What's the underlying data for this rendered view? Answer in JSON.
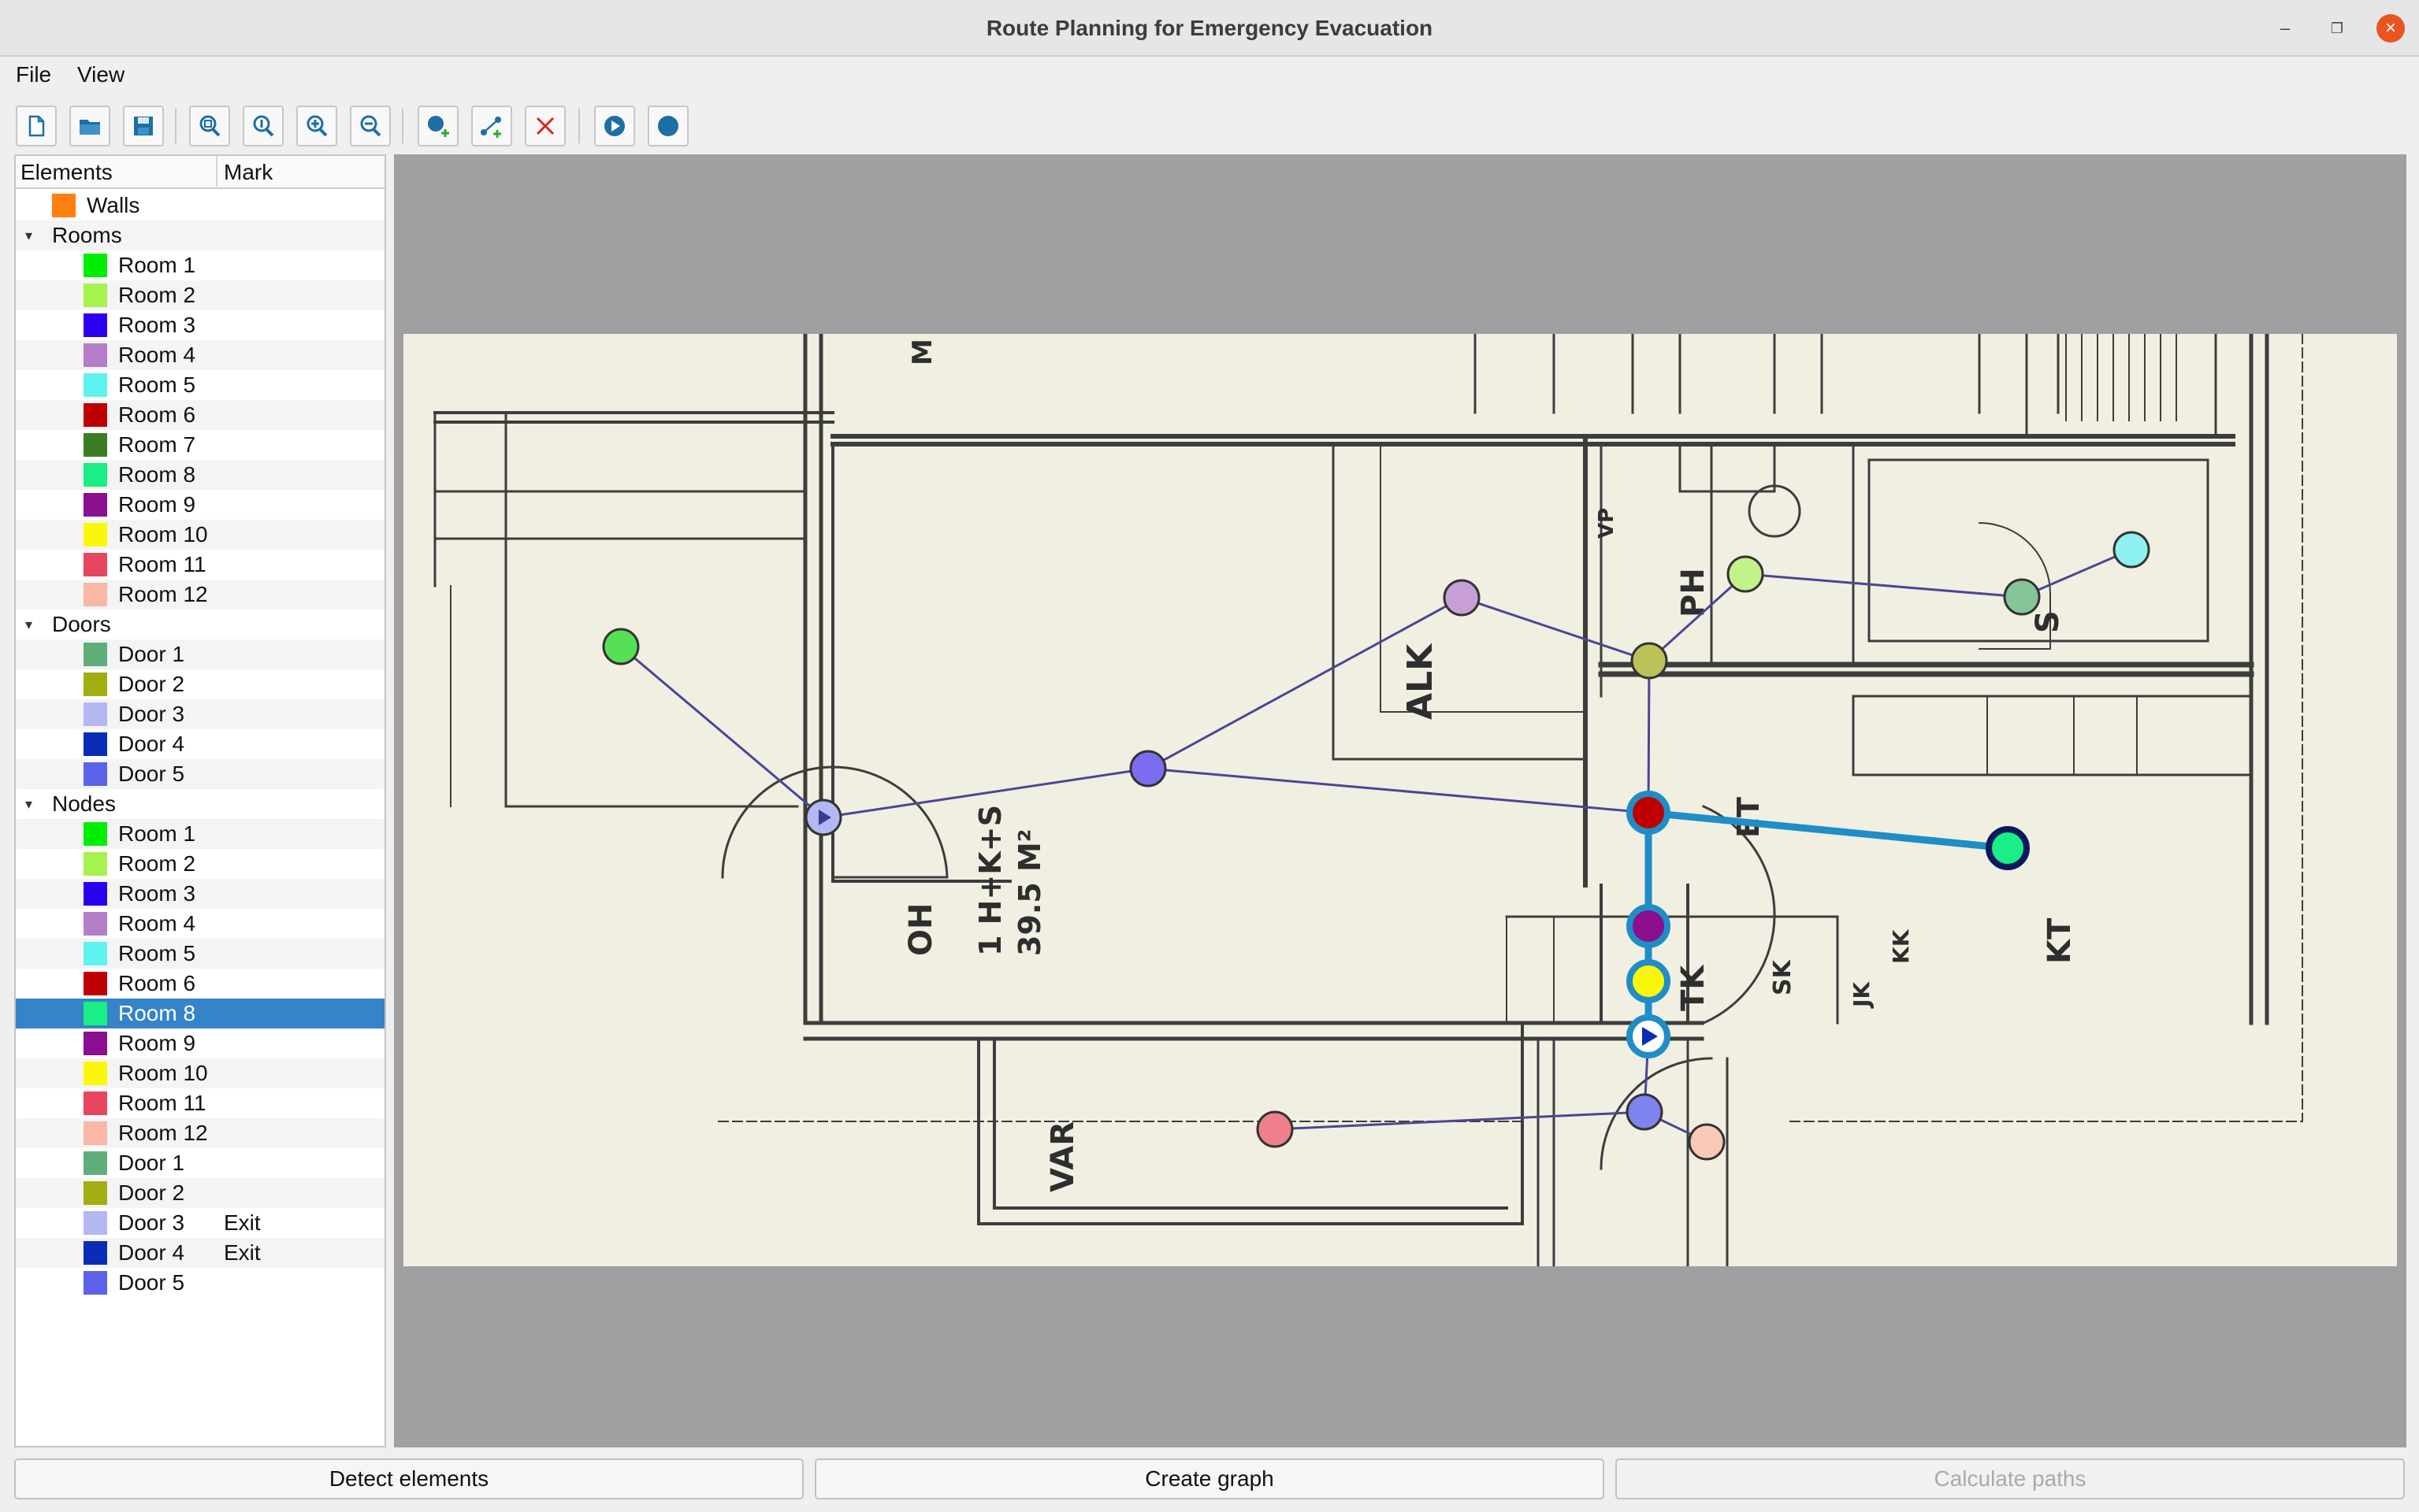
{
  "window": {
    "title": "Route Planning for Emergency Evacuation"
  },
  "menu": {
    "file": "File",
    "view": "View"
  },
  "toolbar": {
    "icons": [
      "new-file-icon",
      "open-folder-icon",
      "save-icon",
      "zoom-fit-icon",
      "zoom-reset-icon",
      "zoom-in-icon",
      "zoom-out-icon",
      "add-node-icon",
      "add-edge-icon",
      "delete-icon",
      "play-icon",
      "record-icon"
    ]
  },
  "panel": {
    "col_elements": "Elements",
    "col_mark": "Mark",
    "walls": {
      "label": "Walls",
      "color": "#ff7f0e"
    },
    "rooms_group": "Rooms",
    "rooms": [
      {
        "label": "Room 1",
        "color": "#00ee00"
      },
      {
        "label": "Room 2",
        "color": "#a6f24f"
      },
      {
        "label": "Room 3",
        "color": "#2b00f0"
      },
      {
        "label": "Room 4",
        "color": "#b57ec8"
      },
      {
        "label": "Room 5",
        "color": "#5ff3f0"
      },
      {
        "label": "Room 6",
        "color": "#c00000"
      },
      {
        "label": "Room 7",
        "color": "#3b7d22"
      },
      {
        "label": "Room 8",
        "color": "#1aee86"
      },
      {
        "label": "Room 9",
        "color": "#8b0f8f"
      },
      {
        "label": "Room 10",
        "color": "#fbf70a"
      },
      {
        "label": "Room 11",
        "color": "#e8455f"
      },
      {
        "label": "Room 12",
        "color": "#f9b7a5"
      }
    ],
    "doors_group": "Doors",
    "doors": [
      {
        "label": "Door 1",
        "color": "#5fae7a"
      },
      {
        "label": "Door 2",
        "color": "#a2ad12"
      },
      {
        "label": "Door 3",
        "color": "#b3b8f2"
      },
      {
        "label": "Door 4",
        "color": "#0a2db8"
      },
      {
        "label": "Door 5",
        "color": "#5d62ea"
      }
    ],
    "nodes_group": "Nodes",
    "nodes": [
      {
        "label": "Room 1",
        "color": "#00ee00",
        "mark": ""
      },
      {
        "label": "Room 2",
        "color": "#a6f24f",
        "mark": ""
      },
      {
        "label": "Room 3",
        "color": "#2b00f0",
        "mark": ""
      },
      {
        "label": "Room 4",
        "color": "#b57ec8",
        "mark": ""
      },
      {
        "label": "Room 5",
        "color": "#5ff3f0",
        "mark": ""
      },
      {
        "label": "Room 6",
        "color": "#c00000",
        "mark": ""
      },
      {
        "label": "Room 8",
        "color": "#1aee86",
        "mark": ""
      },
      {
        "label": "Room 9",
        "color": "#8b0f8f",
        "mark": ""
      },
      {
        "label": "Room 10",
        "color": "#fbf70a",
        "mark": ""
      },
      {
        "label": "Room 11",
        "color": "#e8455f",
        "mark": ""
      },
      {
        "label": "Room 12",
        "color": "#f9b7a5",
        "mark": ""
      },
      {
        "label": "Door 1",
        "color": "#5fae7a",
        "mark": ""
      },
      {
        "label": "Door 2",
        "color": "#a2ad12",
        "mark": ""
      },
      {
        "label": "Door 3",
        "color": "#b3b8f2",
        "mark": "Exit"
      },
      {
        "label": "Door 4",
        "color": "#0a2db8",
        "mark": "Exit"
      },
      {
        "label": "Door 5",
        "color": "#5d62ea",
        "mark": ""
      }
    ],
    "selected_node": "Room 8"
  },
  "floorplan": {
    "labels": {
      "oh": "OH",
      "area": "1 H+K+S",
      "size": "39.5 M²",
      "alk": "ALK",
      "ph": "PH",
      "et": "ET",
      "tk": "TK",
      "kt": "KT",
      "var": "VAR",
      "s": "S",
      "sk": "SK",
      "jk": "JK",
      "kk": "KK",
      "vp": "VP",
      "m": "M"
    },
    "path_color": "#1f8dc6",
    "edge_color": "#4b4696"
  },
  "buttons": {
    "detect": "Detect elements",
    "graph": "Create graph",
    "calculate": "Calculate paths"
  }
}
